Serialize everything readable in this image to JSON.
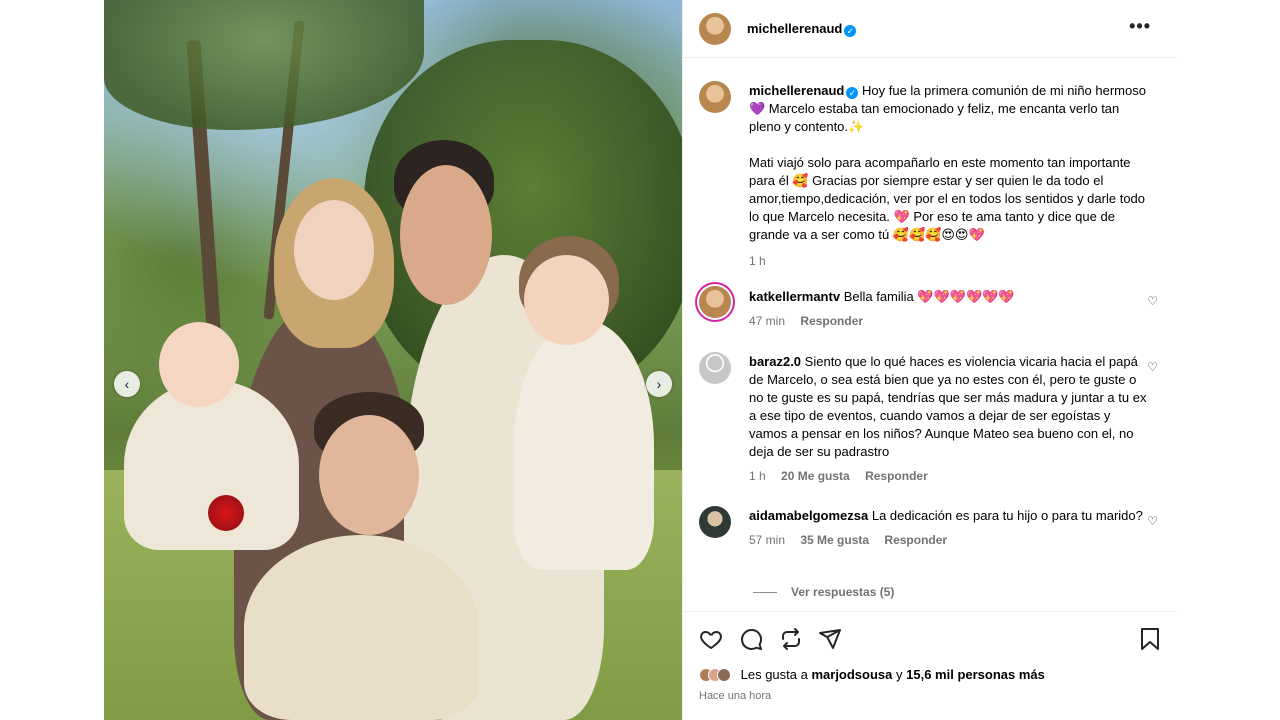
{
  "post": {
    "username": "michellerenaud",
    "verified_icon": "verified-badge",
    "more_icon": "more-options-icon"
  },
  "caption": {
    "username": "michellerenaud",
    "paragraph1": "Hoy fue la primera comunión de mi niño hermoso 💜 Marcelo estaba tan emocionado y feliz, me encanta verlo tan pleno y contento.✨",
    "paragraph2": "Mati viajó solo para acompañarlo en este momento tan importante para él 🥰 Gracias por siempre estar y ser quien le da todo el amor,tiempo,dedicación, ver por el en todos los sentidos y darle todo lo que Marcelo necesita. 💖 Por eso te ama tanto y dice que de grande va a ser como tú 🥰🥰🥰😍😍💖",
    "time": "1 h"
  },
  "comments": [
    {
      "username": "katkellermantv",
      "text": "Bella familia 💖💖💖💖💖💖",
      "time": "47 min",
      "likes": "",
      "reply": "Responder"
    },
    {
      "username": "baraz2.0",
      "text": "Siento que lo qué haces es violencia vicaria hacia el papá de Marcelo, o sea está bien que ya no estes con él, pero te guste o no te guste es su papá, tendrías que ser más madura y juntar a tu ex a ese tipo de eventos, cuando vamos a dejar de ser egoístas y vamos a pensar en los niños? Aunque Mateo sea bueno con el, no deja de ser su padrastro",
      "time": "1 h",
      "likes": "20 Me gusta",
      "reply": "Responder"
    },
    {
      "username": "aidamabelgomezsa",
      "text": "La dedicación es para tu hijo o para tu marido?",
      "time": "57 min",
      "likes": "35 Me gusta",
      "reply": "Responder"
    }
  ],
  "view_replies": "Ver respuestas (5)",
  "likes_line": {
    "prefix": "Les gusta a",
    "user": "marjodsousa",
    "middle": "y",
    "count": "15,6 mil personas más"
  },
  "posted_ago": "Hace una hora",
  "icons": [
    "heart-icon",
    "comment-icon",
    "share-icon",
    "send-icon",
    "bookmark-icon"
  ]
}
